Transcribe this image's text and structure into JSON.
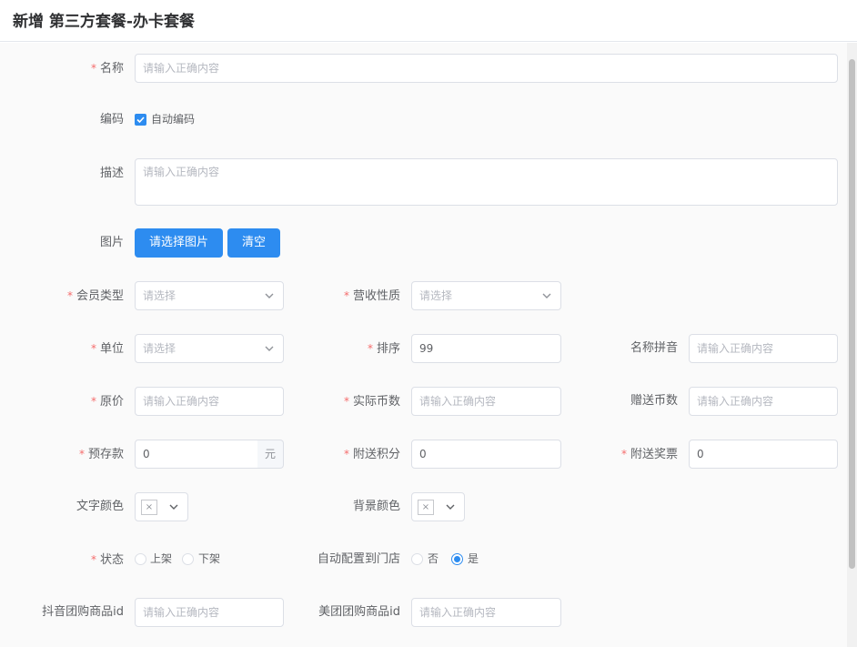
{
  "header": {
    "title": "新增 第三方套餐-办卡套餐"
  },
  "form": {
    "name": {
      "label": "名称",
      "placeholder": "请输入正确内容"
    },
    "code": {
      "label": "编码",
      "auto_code_label": "自动编码",
      "auto_code_checked": true
    },
    "description": {
      "label": "描述",
      "placeholder": "请输入正确内容"
    },
    "image": {
      "label": "图片",
      "select_button": "请选择图片",
      "clear_button": "清空"
    },
    "member_type": {
      "label": "会员类型",
      "placeholder": "请选择"
    },
    "revenue_nature": {
      "label": "营收性质",
      "placeholder": "请选择"
    },
    "unit": {
      "label": "单位",
      "placeholder": "请选择"
    },
    "sort": {
      "label": "排序",
      "value": "99"
    },
    "name_pinyin": {
      "label": "名称拼音",
      "placeholder": "请输入正确内容"
    },
    "original_price": {
      "label": "原价",
      "placeholder": "请输入正确内容"
    },
    "actual_coins": {
      "label": "实际币数",
      "placeholder": "请输入正确内容"
    },
    "bonus_coins": {
      "label": "赠送币数",
      "placeholder": "请输入正确内容"
    },
    "deposit": {
      "label": "预存款",
      "value": "0",
      "unit": "元"
    },
    "bonus_points": {
      "label": "附送积分",
      "value": "0"
    },
    "bonus_tickets": {
      "label": "附送奖票",
      "value": "0"
    },
    "text_color": {
      "label": "文字颜色",
      "empty_mark": "×"
    },
    "bg_color": {
      "label": "背景颜色",
      "empty_mark": "×"
    },
    "status": {
      "label": "状态",
      "options": [
        "上架",
        "下架"
      ],
      "selected": null
    },
    "auto_config": {
      "label": "自动配置到门店",
      "options": [
        "否",
        "是"
      ],
      "selected": "是"
    },
    "douyin_id": {
      "label": "抖音团购商品id",
      "placeholder": "请输入正确内容"
    },
    "meituan_id": {
      "label": "美团团购商品id",
      "placeholder": "请输入正确内容"
    }
  },
  "colors": {
    "accent": "#2d8cf0",
    "required": "#f56c6c"
  }
}
